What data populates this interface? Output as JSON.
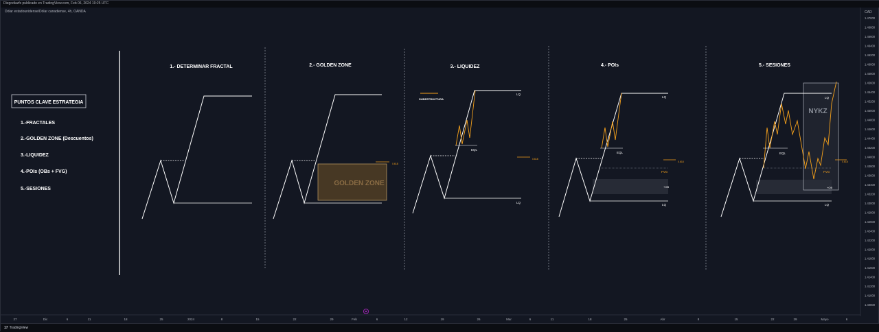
{
  "header": {
    "published": "Diegodiazfx publicado en TradingView.com, Feb 06, 2024 19:25 UTC",
    "symbol": "Dólar estadounidense/Dólar canadiense, 4h, OANDA"
  },
  "footer": {
    "brand": "TradingView",
    "brand_mark": "17"
  },
  "colors": {
    "background": "#131722",
    "line": "#ffffff",
    "accent": "#f7a21b",
    "golden_zone": "#5a4426",
    "box": "#2a2e39"
  },
  "legend": {
    "title": "PUNTOS CLAVE ESTRATEGIA",
    "items": [
      "1.-FRACTALES",
      "2.-GOLDEN ZONE (Descuentos)",
      "3.-LIQUIDEZ",
      "4.-POIs (OBs + FVG)",
      "5.-SESIONES"
    ]
  },
  "panels": [
    {
      "title": "1.- DETERMINAR  FRACTAL"
    },
    {
      "title": "2.- GOLDEN ZONE",
      "zone_label": "GOLDEN ZONE",
      "fib": "0.618"
    },
    {
      "title": "3.- LIQUIDEZ",
      "sub_label": "SUBESTRUCTURA",
      "eql": "EQL",
      "lq_top": "LQ",
      "lq_bottom": "LQ",
      "fib": "0.618"
    },
    {
      "title": "4.- POIs",
      "eql": "EQL",
      "lq_top": "LQ",
      "lq_bottom": "LQ",
      "fvg": "FVG",
      "ob": "+OB",
      "fib": "0.618"
    },
    {
      "title": "5.- SESIONES",
      "session": "NYKZ",
      "eql": "EQL",
      "lq_top": "LQ",
      "lq_bottom": "LQ",
      "fvg": "FVG",
      "ob": "+OB",
      "fib": "0.618"
    }
  ],
  "chart_data": {
    "type": "line",
    "price_axis": {
      "currency": "CAD",
      "ticks": [
        "1.47000",
        "1.46800",
        "1.46600",
        "1.46400",
        "1.46200",
        "1.46000",
        "1.45800",
        "1.45600",
        "1.45400",
        "1.45200",
        "1.45000",
        "1.44800",
        "1.44600",
        "1.44400",
        "1.44200",
        "1.44000",
        "1.43800",
        "1.43600",
        "1.43400",
        "1.43200",
        "1.43000",
        "1.42800",
        "1.42600",
        "1.42400",
        "1.42200",
        "1.42000",
        "1.41800",
        "1.41600",
        "1.41400",
        "1.41200",
        "1.41000",
        "1.40800"
      ]
    },
    "time_axis": {
      "ticks": [
        "27",
        "Dic",
        "6",
        "11",
        "18",
        "25",
        "2024",
        "8",
        "15",
        "22",
        "29",
        "Feb",
        "6",
        "12",
        "19",
        "26",
        "Mar",
        "6",
        "11",
        "18",
        "25",
        "Abr",
        "8",
        "15",
        "22",
        "29",
        "Mayo",
        "6"
      ]
    }
  }
}
